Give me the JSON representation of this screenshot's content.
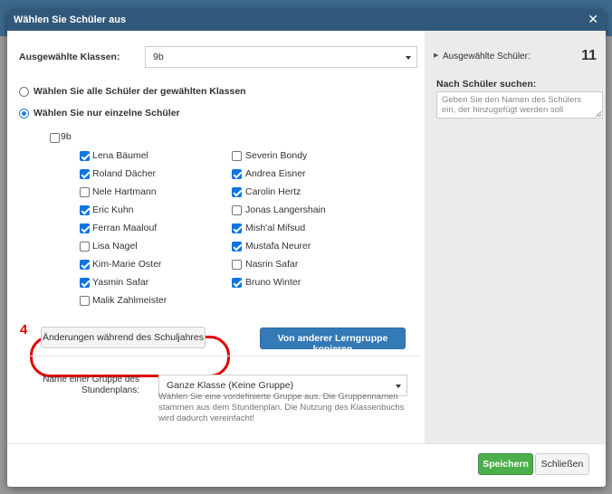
{
  "modal": {
    "title": "Wählen Sie Schüler aus",
    "close_glyph": "✕"
  },
  "class_select": {
    "label": "Ausgewählte Klassen:",
    "value": "9b"
  },
  "mode": {
    "options": [
      {
        "label": "Wählen Sie alle Schüler der gewählten Klassen",
        "selected": false
      },
      {
        "label": "Wählen Sie nur einzelne Schüler",
        "selected": true
      }
    ]
  },
  "group_checkbox": {
    "label": "9b",
    "checked": false
  },
  "students": {
    "col1": [
      {
        "name": "Lena Bäumel",
        "checked": true
      },
      {
        "name": "Roland Dächer",
        "checked": true
      },
      {
        "name": "Nele Hartmann",
        "checked": false
      },
      {
        "name": "Eric Kuhn",
        "checked": true
      },
      {
        "name": "Ferran Maalouf",
        "checked": true
      },
      {
        "name": "Lisa Nagel",
        "checked": false
      },
      {
        "name": "Kim-Marie Oster",
        "checked": true
      },
      {
        "name": "Yasmin Safar",
        "checked": true
      },
      {
        "name": "Malik Zahlmeister",
        "checked": false
      }
    ],
    "col2": [
      {
        "name": "Severin Bondy",
        "checked": false
      },
      {
        "name": "Andrea Eisner",
        "checked": true
      },
      {
        "name": "Carolin Hertz",
        "checked": true
      },
      {
        "name": "Jonas Langershain",
        "checked": false
      },
      {
        "name": "Mish'al Mifsud",
        "checked": true
      },
      {
        "name": "Mustafa Neurer",
        "checked": true
      },
      {
        "name": "Nasrin Safar",
        "checked": false
      },
      {
        "name": "Bruno Winter",
        "checked": true
      }
    ]
  },
  "annotation": {
    "number": "4",
    "color": "#e00000"
  },
  "buttons": {
    "changes": "Änderungen während des Schuljahres",
    "copy": "Von anderer Lerngruppe kopieren",
    "save": "Speichern",
    "close": "Schließen"
  },
  "timetable_group": {
    "label_line1": "Name einer Gruppe des",
    "label_line2": "Stundenplans:",
    "value": "Ganze Klasse (Keine Gruppe)",
    "help": "Wählen Sie eine vordefinierte Gruppe aus. Die Gruppennamen stammen aus dem Stundenplan. Die Nutzung des Klassenbuchs wird dadurch vereinfacht!"
  },
  "sidebar": {
    "selected_label": "Ausgewählte Schüler:",
    "selected_count": "11",
    "search_label": "Nach Schüler suchen:",
    "search_placeholder": "Geben Sie den Namen des Schülers ein, der hinzugefügt werden soll"
  },
  "colors": {
    "header": "#31587a",
    "primary": "#337ab7",
    "success": "#4cae4c",
    "checkbox": "#0b75e0"
  }
}
